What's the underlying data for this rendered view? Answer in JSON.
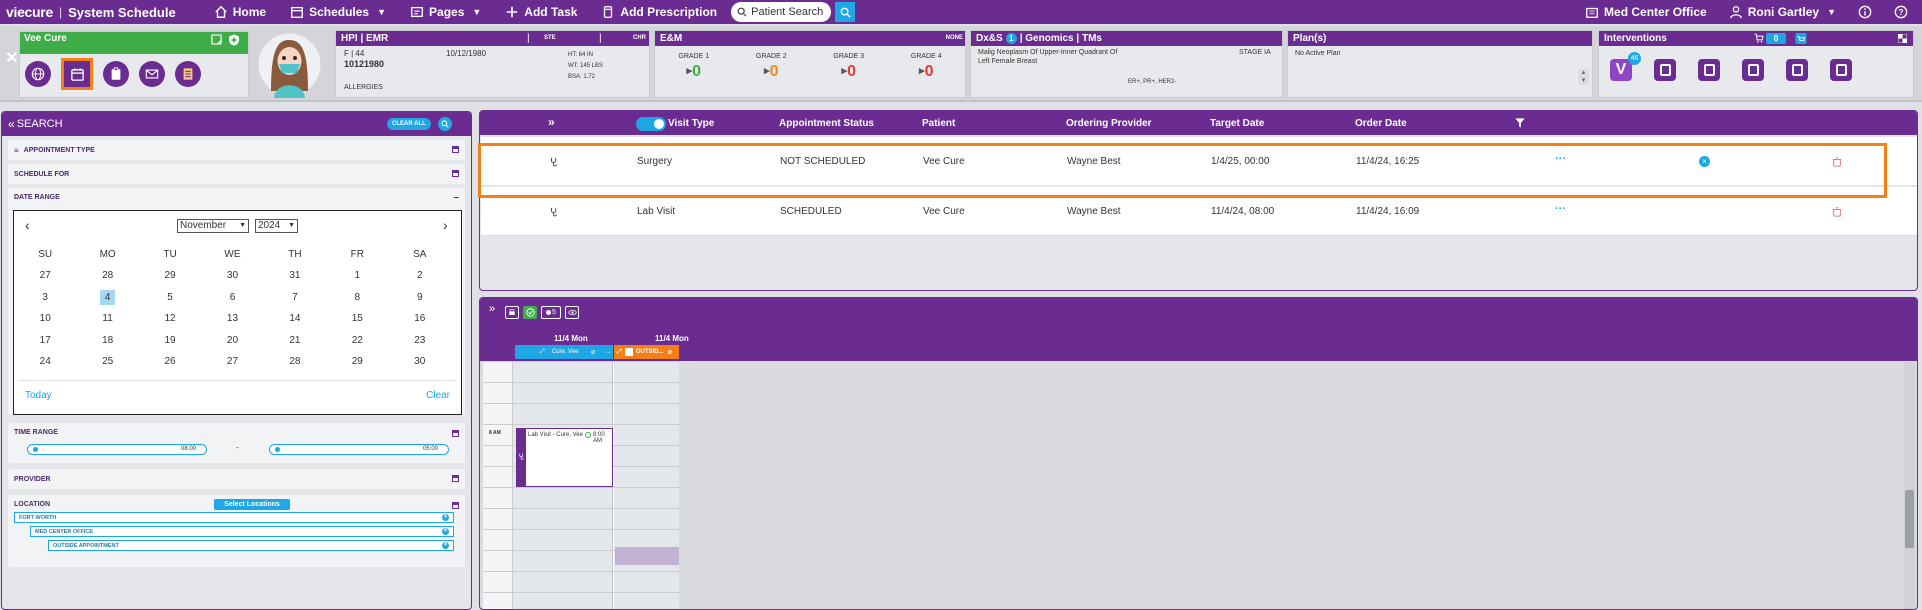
{
  "topbar": {
    "brand": "viecure",
    "title": "System Schedule",
    "nav": {
      "home": "Home",
      "schedules": "Schedules",
      "pages": "Pages",
      "add_task": "Add Task",
      "add_prescription": "Add Prescription"
    },
    "patient_search_placeholder": "Patient Search",
    "location": "Med Center Office",
    "user": "Roni Gartley"
  },
  "banner": {
    "patient_card_title": "Vee Cure",
    "hpi": {
      "title": "HPI | EMR",
      "sex_age": "F | 44",
      "mrn": "10121980",
      "dob": "10/12/1980",
      "allergies": "ALLERGIES",
      "ste": "STE",
      "chr": "CHR",
      "ht": "HT: 64 IN",
      "wt": "WT: 145 LBS",
      "bsa": "BSA: 1.72"
    },
    "em": {
      "title": "E&M",
      "none": "NONE",
      "grades": [
        {
          "label": "GRADE 1",
          "value": "0",
          "color": "#3fae49"
        },
        {
          "label": "GRADE 2",
          "value": "0",
          "color": "#f08a24"
        },
        {
          "label": "GRADE 3",
          "value": "0",
          "color": "#e53935"
        },
        {
          "label": "GRADE 4",
          "value": "0",
          "color": "#e53935"
        }
      ]
    },
    "dx": {
      "title_a": "Dx&S",
      "badge": "1",
      "title_b": "| Genomics | TMs",
      "diagnosis_line1": "Malig Neoplasm Of Upper-Inner Quadrant Of",
      "diagnosis_line2": "Left Female Breast",
      "stage": "STAGE IA",
      "markers": "ER+, PR+, HER2-"
    },
    "plan": {
      "title": "Plan(s)",
      "text": "No Active Plan"
    },
    "interventions": {
      "title": "Interventions",
      "cart_count": "0",
      "v_badge": "46"
    }
  },
  "search_panel": {
    "title": "SEARCH",
    "clear_all": "CLEAR ALL",
    "sections": {
      "appointment_type": "APPOINTMENT TYPE",
      "schedule_for": "SCHEDULE FOR",
      "date_range": "DATE RANGE",
      "time_range": "TIME RANGE",
      "provider": "PROVIDER",
      "location": "LOCATION"
    },
    "calendar": {
      "month": "November",
      "year": "2024",
      "weekdays": [
        "SU",
        "MO",
        "TU",
        "WE",
        "TH",
        "FR",
        "SA"
      ],
      "weeks": [
        [
          "27",
          "28",
          "29",
          "30",
          "31",
          "1",
          "2"
        ],
        [
          "3",
          "4",
          "5",
          "6",
          "7",
          "8",
          "9"
        ],
        [
          "10",
          "11",
          "12",
          "13",
          "14",
          "15",
          "16"
        ],
        [
          "17",
          "18",
          "19",
          "20",
          "21",
          "22",
          "23"
        ],
        [
          "24",
          "25",
          "26",
          "27",
          "28",
          "29",
          "30"
        ]
      ],
      "selected": "4",
      "today": "Today",
      "clear": "Clear"
    },
    "time_from": "08:00",
    "time_sep": "-",
    "time_to": "05:00",
    "select_locations": "Select Locations",
    "locations": [
      "FORT WORTH",
      "MED CENTER OFFICE",
      "OUTSIDE APPOINTMENT"
    ]
  },
  "grid": {
    "headers": {
      "visit_type": "Visit Type",
      "status": "Appointment Status",
      "patient": "Patient",
      "provider": "Ordering Provider",
      "target": "Target Date",
      "order": "Order Date"
    },
    "rows": [
      {
        "visit_type": "Surgery",
        "status": "NOT SCHEDULED",
        "patient": "Vee Cure",
        "provider": "Wayne Best",
        "target": "1/4/25, 00:00",
        "order": "11/4/24, 16:25"
      },
      {
        "visit_type": "Lab Visit",
        "status": "SCHEDULED",
        "patient": "Vee Cure",
        "provider": "Wayne Best",
        "target": "11/4/24, 08:00",
        "order": "11/4/24, 16:09"
      }
    ],
    "more": "···"
  },
  "scheduler": {
    "count_badge": "5",
    "col1_date": "11/4 Mon",
    "col1_name": "Cure, Vee",
    "col2_date": "11/4 Mon",
    "col2_name": "OUTSID...",
    "time_label": "8 AM",
    "event_text": "Lab Visit - Cure, Vee",
    "event_time": "8:00 AM"
  }
}
